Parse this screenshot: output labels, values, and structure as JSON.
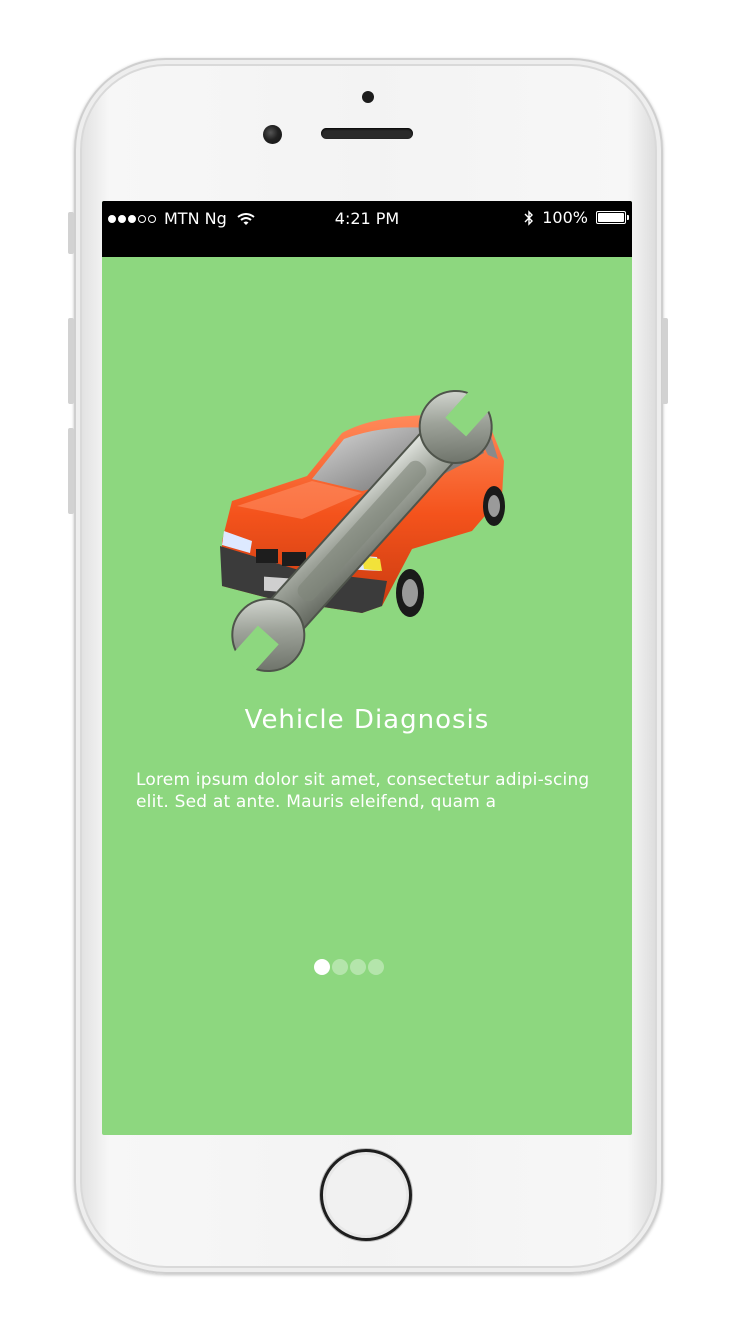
{
  "status_bar": {
    "signal_bars_filled": 3,
    "signal_bars_total": 5,
    "carrier": "MTN Ng",
    "time": "4:21 PM",
    "battery_percent": "100%",
    "battery_level": 1.0,
    "icons": [
      "signal-dots-icon",
      "wifi-icon",
      "bluetooth-icon",
      "battery-icon"
    ]
  },
  "onboarding": {
    "illustration": "car-wrench-icon",
    "title": "Vehicle Diagnosis",
    "description": "Lorem ipsum dolor sit amet, consectetur adipi-scing elit. Sed at ante. Mauris eleifend, quam a",
    "page_indicator": {
      "total": 4,
      "active_index": 0
    }
  },
  "colors": {
    "screen_background": "#8dd77f",
    "status_bar_background": "#000000",
    "car_body": "#ff5a1e",
    "text": "#ffffff"
  }
}
